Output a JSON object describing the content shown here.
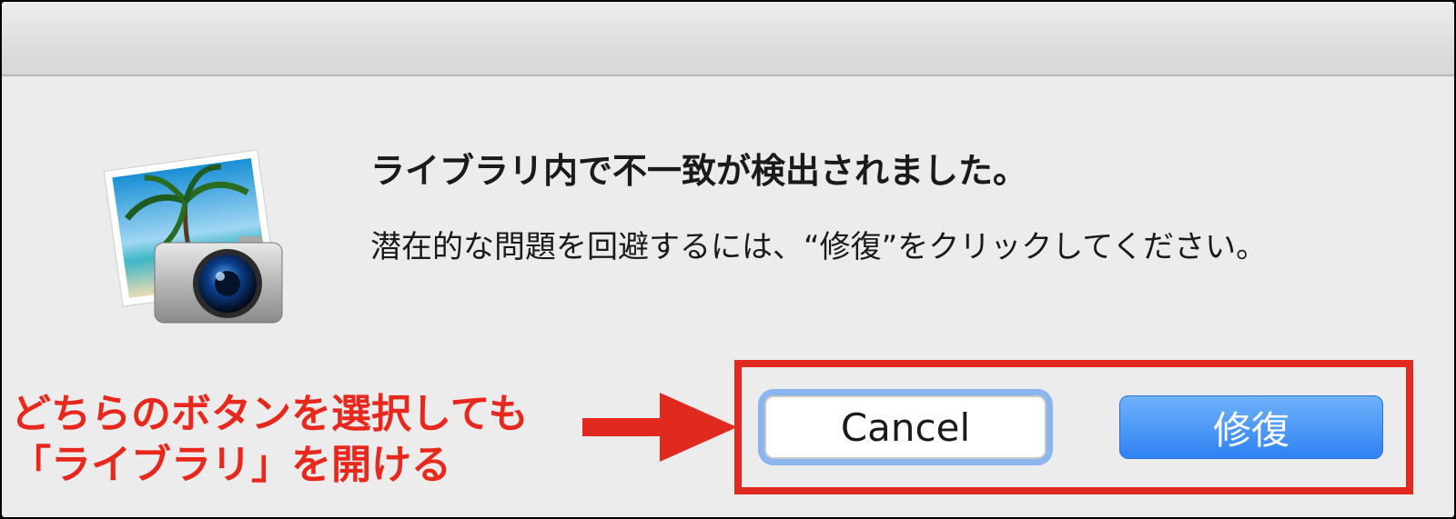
{
  "dialog": {
    "title": "ライブラリ内で不一致が検出されました。",
    "message": "潜在的な問題を回避するには、“修復”をクリックしてください。",
    "buttons": {
      "cancel_label": "Cancel",
      "repair_label": "修復"
    }
  },
  "annotation": {
    "line1": "どちらのボタンを選択しても",
    "line2": "「ライブラリ」を開ける",
    "color": "#e8271d"
  },
  "icons": {
    "app_icon": "iphoto-camera-icon"
  },
  "colors": {
    "accent": "#2f82f3",
    "focus_ring": "#8ab5ee",
    "highlight": "#e02a20"
  }
}
